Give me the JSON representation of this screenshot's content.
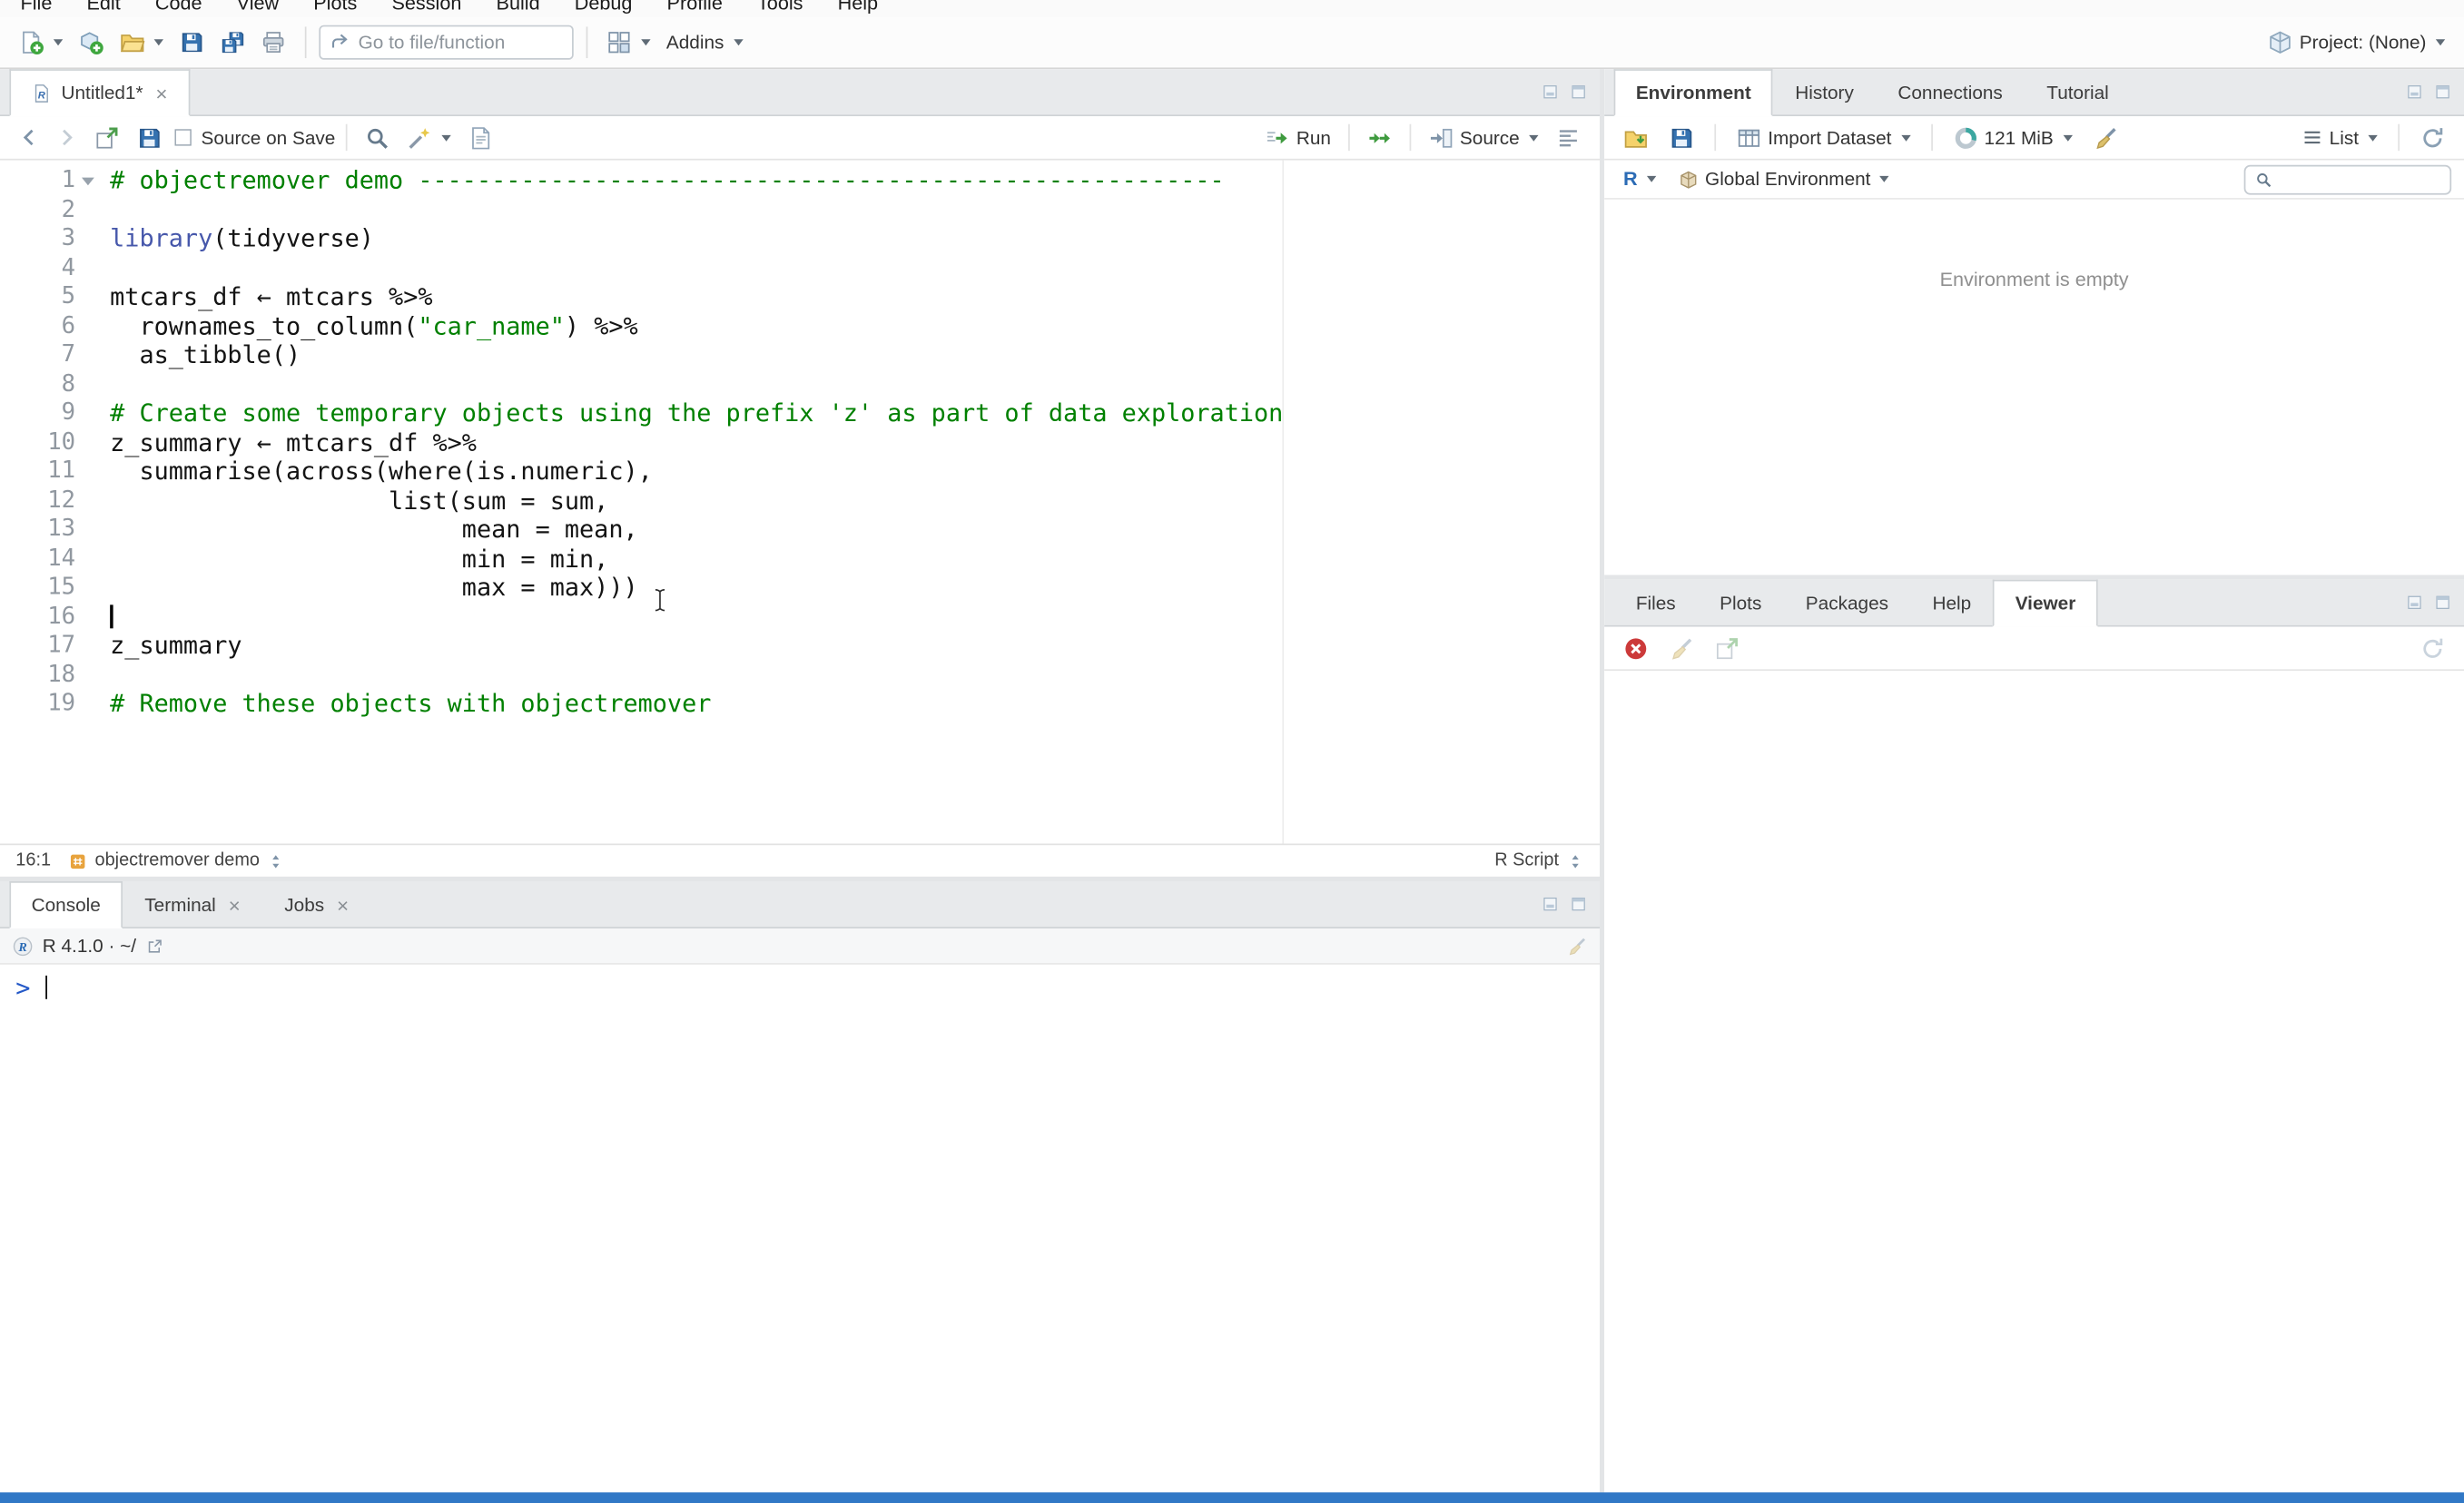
{
  "menu": {
    "items": [
      "File",
      "Edit",
      "Code",
      "View",
      "Plots",
      "Session",
      "Build",
      "Debug",
      "Profile",
      "Tools",
      "Help"
    ]
  },
  "toolbar": {
    "goto_placeholder": "Go to file/function",
    "addins_label": "Addins",
    "project_label": "Project: (None)"
  },
  "source_pane": {
    "tab_title": "Untitled1*",
    "toolbar": {
      "source_on_save": "Source on Save",
      "run_label": "Run",
      "source_label": "Source"
    },
    "status": {
      "cursor_pos": "16:1",
      "section": "objectremover demo",
      "file_type": "R Script"
    },
    "code": {
      "cursor_line": 16,
      "lines": [
        [
          {
            "t": "# objectremover demo -------------------------------------------------------",
            "c": "c"
          }
        ],
        [],
        [
          {
            "t": "library",
            "c": "k"
          },
          {
            "t": "(tidyverse)",
            "c": "p"
          }
        ],
        [],
        [
          {
            "t": "mtcars_df ← mtcars %>%",
            "c": "p"
          }
        ],
        [
          {
            "t": "  rownames_to_column(",
            "c": "p"
          },
          {
            "t": "\"car_name\"",
            "c": "s"
          },
          {
            "t": ") %>%",
            "c": "p"
          }
        ],
        [
          {
            "t": "  as_tibble()",
            "c": "p"
          }
        ],
        [],
        [
          {
            "t": "# Create some temporary objects using the prefix 'z' as part of data exploration",
            "c": "c"
          }
        ],
        [
          {
            "t": "z_summary ← mtcars_df %>%",
            "c": "p"
          }
        ],
        [
          {
            "t": "  summarise(across(where(is.numeric),",
            "c": "p"
          }
        ],
        [
          {
            "t": "                   list(sum = sum,",
            "c": "p"
          }
        ],
        [
          {
            "t": "                        mean = mean,",
            "c": "p"
          }
        ],
        [
          {
            "t": "                        min = min,",
            "c": "p"
          }
        ],
        [
          {
            "t": "                        max = max)))",
            "c": "p"
          }
        ],
        [],
        [
          {
            "t": "z_summary",
            "c": "p"
          }
        ],
        [],
        [
          {
            "t": "# Remove these objects with objectremover",
            "c": "c"
          }
        ]
      ]
    }
  },
  "console_pane": {
    "tabs": [
      {
        "label": "Console"
      },
      {
        "label": "Terminal",
        "closable": true
      },
      {
        "label": "Jobs",
        "closable": true
      }
    ],
    "active_tab": "Console",
    "header": "R 4.1.0 · ~/",
    "prompt": ">"
  },
  "environment_pane": {
    "tabs": [
      {
        "label": "Environment"
      },
      {
        "label": "History"
      },
      {
        "label": "Connections"
      },
      {
        "label": "Tutorial"
      }
    ],
    "active_tab": "Environment",
    "toolbar": {
      "import_label": "Import Dataset",
      "memory_label": "121 MiB",
      "list_label": "List"
    },
    "scope_row": {
      "language": "R",
      "scope": "Global Environment"
    },
    "empty_message": "Environment is empty"
  },
  "files_pane": {
    "tabs": [
      {
        "label": "Files"
      },
      {
        "label": "Plots"
      },
      {
        "label": "Packages"
      },
      {
        "label": "Help"
      },
      {
        "label": "Viewer"
      }
    ],
    "active_tab": "Viewer"
  },
  "colors": {
    "comment": "#008000",
    "string": "#008000",
    "keyword": "#4758AB",
    "console_prompt": "#2458C7",
    "run_green": "#3F9B3F",
    "taskbar": "#3178C6"
  },
  "icons": [
    "new-file-icon",
    "new-project-icon",
    "open-folder-icon",
    "save-icon",
    "save-all-icon",
    "print-icon",
    "goto-icon",
    "grid-icon",
    "project-cube-icon",
    "back-icon",
    "forward-icon",
    "popout-icon",
    "checkbox-icon",
    "find-icon",
    "wand-icon",
    "notebook-icon",
    "run-icon",
    "rerun-icon",
    "source-icon",
    "outline-icon",
    "minimize-icon",
    "maximize-icon",
    "r-script-icon",
    "r-logo-icon",
    "link-icon",
    "broom-icon",
    "import-table-icon",
    "memory-donut-icon",
    "list-icon",
    "refresh-icon",
    "load-workspace-icon",
    "global-environment-cube-icon",
    "search-icon",
    "stop-icon",
    "section-icon",
    "updown-icon",
    "ibeam-cursor",
    "fold-arrow-icon",
    "close-icon",
    "caret-down-icon"
  ]
}
